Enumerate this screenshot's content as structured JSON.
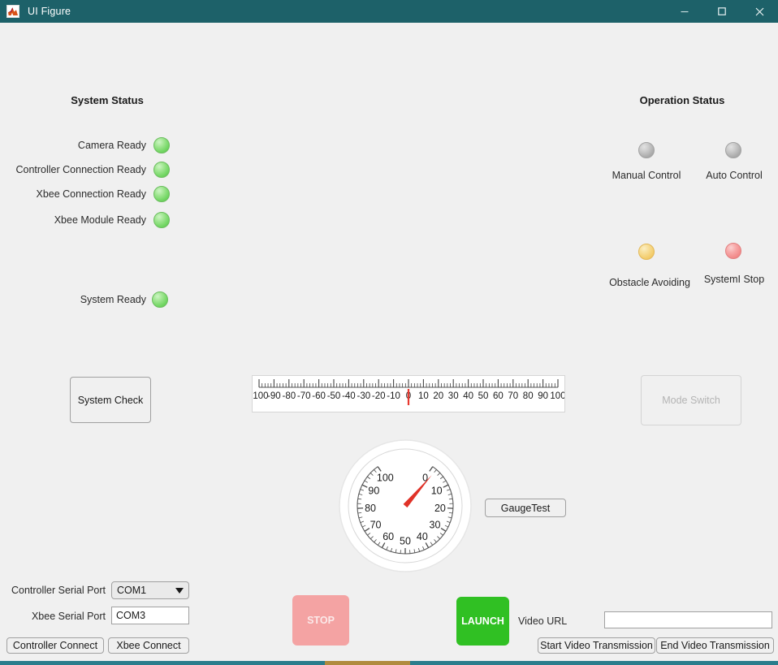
{
  "window": {
    "title": "UI Figure",
    "icon": "matlab-icon",
    "controls": {
      "minimize": "minimize-icon",
      "maximize": "maximize-icon",
      "close": "close-icon"
    },
    "background_color": "#f0f0f0",
    "titlebar_color": "#1d6169"
  },
  "system_status": {
    "title": "System Status",
    "lamps": [
      {
        "label": "Camera Ready",
        "state": "green",
        "color": "#72d663"
      },
      {
        "label": "Controller Connection Ready",
        "state": "green",
        "color": "#72d663"
      },
      {
        "label": "Xbee Connection Ready",
        "state": "green",
        "color": "#72d663"
      },
      {
        "label": "Xbee Module Ready",
        "state": "green",
        "color": "#72d663"
      },
      {
        "label": "System Ready",
        "state": "green",
        "color": "#72d663"
      }
    ],
    "system_check_button": "System Check"
  },
  "operation_status": {
    "title": "Operation Status",
    "lamps": [
      {
        "label": "Manual Control",
        "state": "grey",
        "color": "#ababab"
      },
      {
        "label": "Auto Control",
        "state": "grey",
        "color": "#ababab"
      },
      {
        "label": "Obstacle Avoiding",
        "state": "yellow",
        "color": "#f3cc6b"
      },
      {
        "label": "SystemI Stop",
        "state": "red",
        "color": "#f28b8b"
      }
    ],
    "mode_switch_button": "Mode Switch",
    "mode_switch_enabled": false
  },
  "linear_gauge": {
    "value": 0,
    "min": -100,
    "max": 100,
    "major_step": 10,
    "minor_step": 2,
    "needle_color": "#e8392f",
    "ticks": [
      "-100",
      "-90",
      "-80",
      "-70",
      "-60",
      "-50",
      "-40",
      "-30",
      "-20",
      "-10",
      "0",
      "10",
      "20",
      "30",
      "40",
      "50",
      "60",
      "70",
      "80",
      "90",
      "100"
    ]
  },
  "circular_gauge": {
    "value": 2,
    "min": 0,
    "max": 100,
    "major_step": 10,
    "minor_step": 2,
    "needle_color": "#e03228",
    "ticks": [
      "0",
      "10",
      "20",
      "30",
      "40",
      "50",
      "60",
      "70",
      "80",
      "90",
      "100"
    ],
    "test_button": "GaugeTest"
  },
  "serial": {
    "controller_port_label": "Controller Serial Port",
    "controller_port_value": "COM1",
    "controller_port_options": [
      "COM1"
    ],
    "xbee_port_label": "Xbee Serial Port",
    "xbee_port_value": "COM3",
    "controller_connect_button": "Controller Connect",
    "xbee_connect_button": "Xbee Connect"
  },
  "actions": {
    "stop_button": "STOP",
    "stop_color": "#f4a3a3",
    "launch_button": "LAUNCH",
    "launch_color": "#30c023"
  },
  "video": {
    "url_label": "Video URL",
    "url_value": "",
    "url_placeholder": "",
    "start_button": "Start Video Transmission",
    "end_button": "End Video Transmission"
  }
}
